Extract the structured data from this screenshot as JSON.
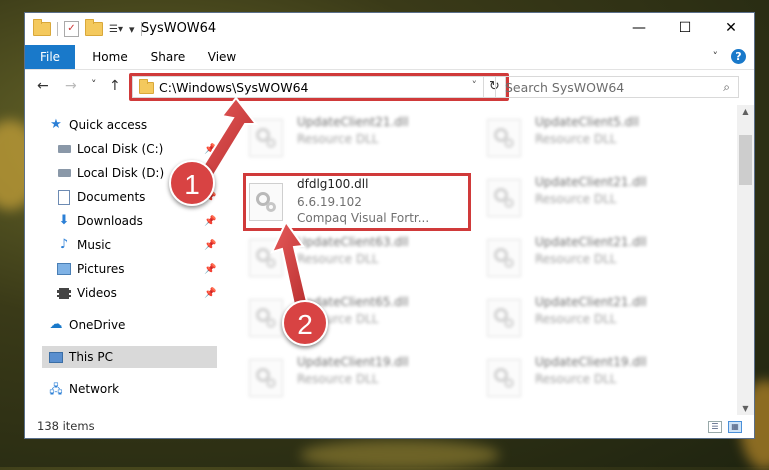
{
  "window": {
    "title": "SysWOW64",
    "controls": {
      "minimize": "—",
      "maximize": "☐",
      "close": "✕"
    }
  },
  "ribbon": {
    "tabs": [
      "File",
      "Home",
      "Share",
      "View"
    ],
    "help": "?"
  },
  "nav": {
    "back": "←",
    "forward": "→",
    "recent": "˅",
    "up": "↑",
    "address": "C:\\Windows\\SysWOW64",
    "search_placeholder": "Search SysWOW64"
  },
  "sidebar": {
    "items": [
      {
        "label": "Quick access",
        "icon": "star-icon",
        "pinned": false
      },
      {
        "label": "Local Disk (C:)",
        "icon": "drive-icon",
        "pinned": true
      },
      {
        "label": "Local Disk (D:)",
        "icon": "drive-icon",
        "pinned": true
      },
      {
        "label": "Documents",
        "icon": "document-icon",
        "pinned": true
      },
      {
        "label": "Downloads",
        "icon": "download-icon",
        "pinned": true
      },
      {
        "label": "Music",
        "icon": "music-icon",
        "pinned": true
      },
      {
        "label": "Pictures",
        "icon": "picture-icon",
        "pinned": true
      },
      {
        "label": "Videos",
        "icon": "video-icon",
        "pinned": true
      },
      {
        "label": "OneDrive",
        "icon": "cloud-icon",
        "pinned": false
      },
      {
        "label": "This PC",
        "icon": "computer-icon",
        "pinned": false,
        "selected": true
      },
      {
        "label": "Network",
        "icon": "network-icon",
        "pinned": false
      }
    ]
  },
  "files": {
    "highlighted": {
      "name": "dfdlg100.dll",
      "version": "6.6.19.102",
      "company": "Compaq Visual Fortr..."
    },
    "col1": [
      {
        "name": "UpdateClient21.dll",
        "type": "Resource DLL"
      },
      {
        "name": "UpdateClient63.dll",
        "type": "Resource DLL"
      },
      {
        "name": "UpdateClient65.dll",
        "type": "Resource DLL"
      },
      {
        "name": "UpdateClient19.dll",
        "type": "Resource DLL"
      }
    ],
    "col2": [
      {
        "name": "UpdateClient5.dll",
        "type": "Resource DLL"
      },
      {
        "name": "UpdateClient21.dll",
        "type": "Resource DLL"
      },
      {
        "name": "UpdateClient21.dll",
        "type": "Resource DLL"
      },
      {
        "name": "UpdateClient21.dll",
        "type": "Resource DLL"
      },
      {
        "name": "UpdateClient19.dll",
        "type": "Resource DLL"
      }
    ]
  },
  "status": {
    "count": "138 items"
  },
  "annotations": {
    "step1": "1",
    "step2": "2"
  },
  "colors": {
    "accent": "#1979ca",
    "highlight": "#d03a3a",
    "badge": "#d84343"
  }
}
